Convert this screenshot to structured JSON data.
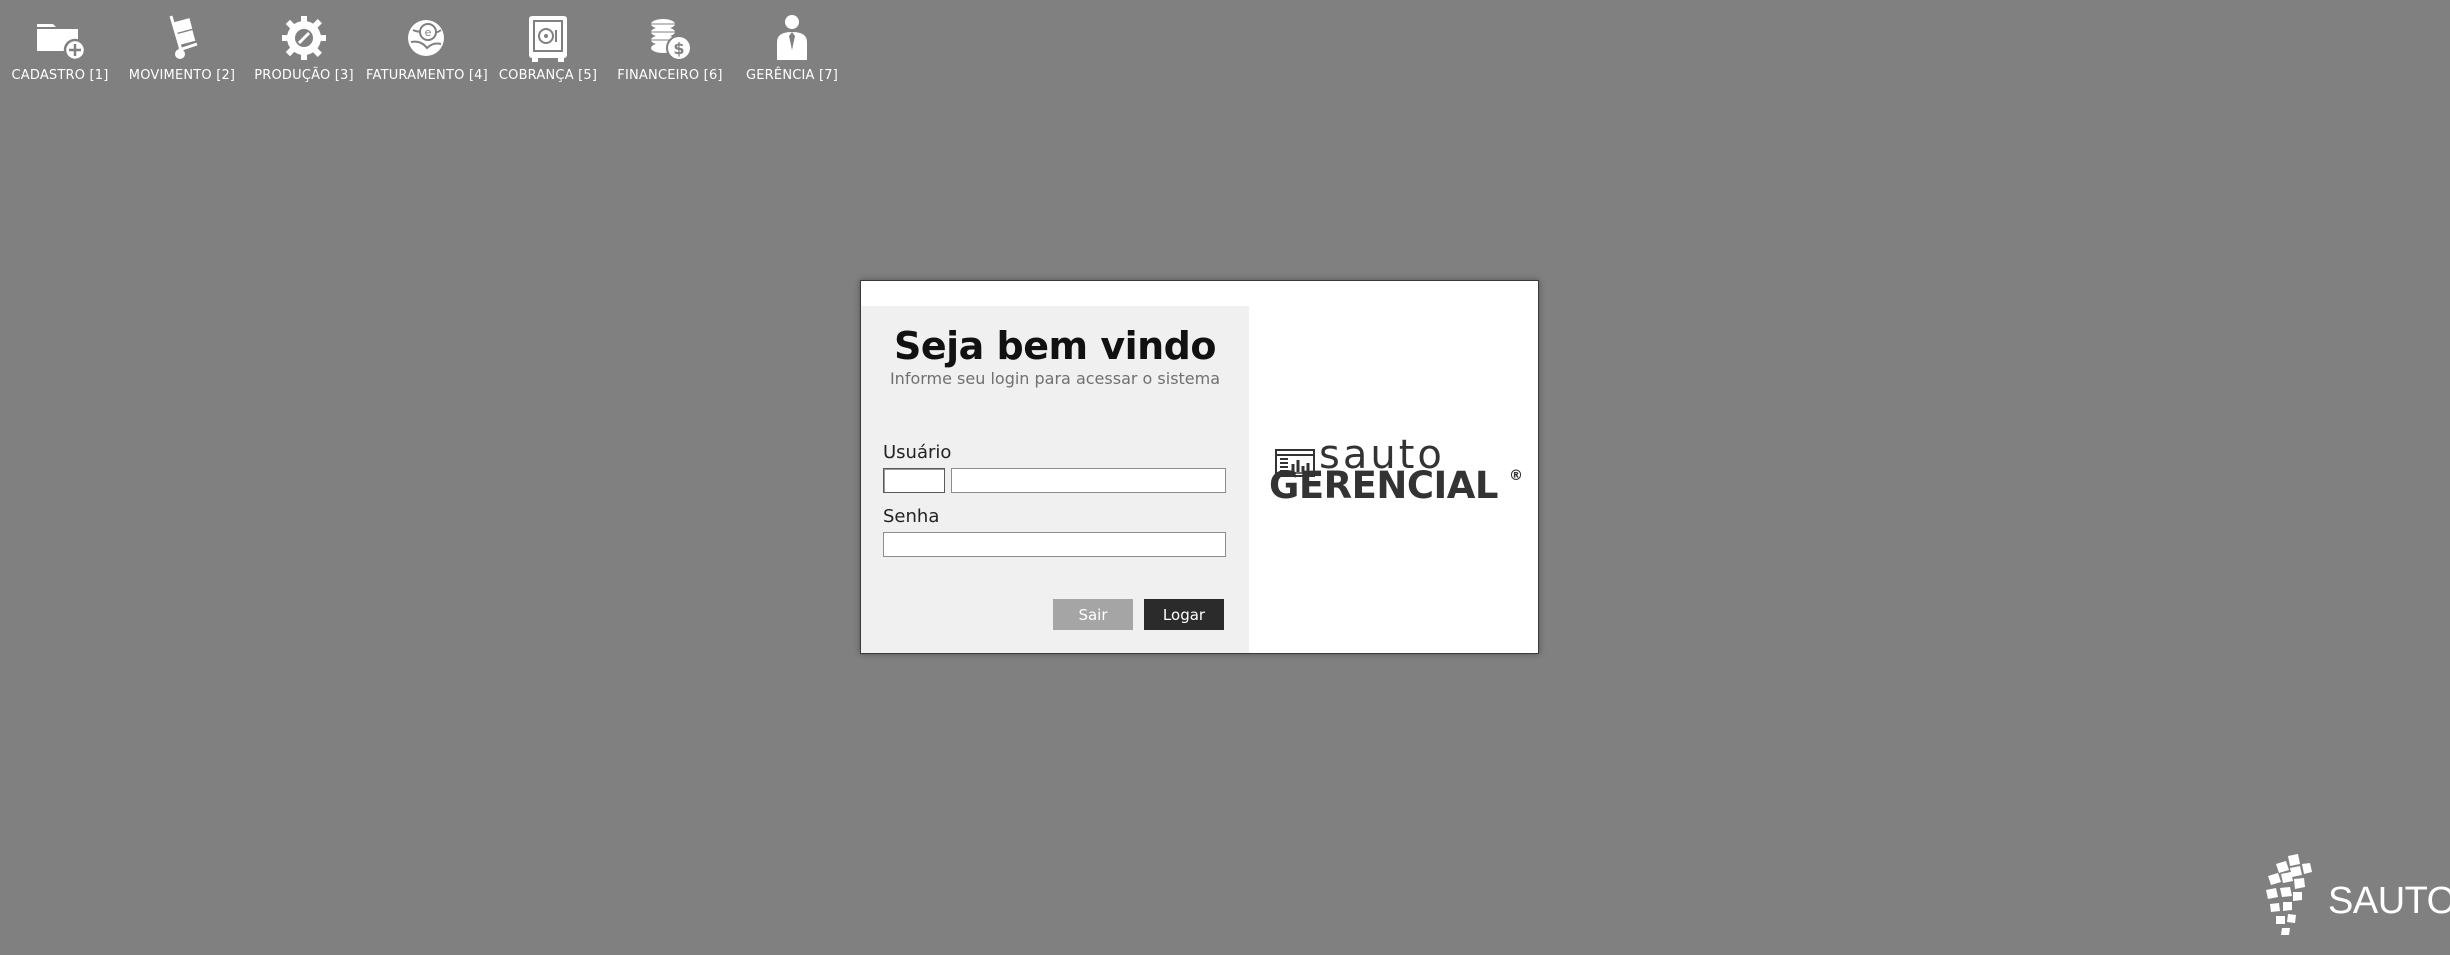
{
  "menu": [
    {
      "label": "CADASTRO [1]",
      "icon": "folder-add-icon"
    },
    {
      "label": "MOVIMENTO [2]",
      "icon": "hand-truck-icon"
    },
    {
      "label": "PRODUÇÃO [3]",
      "icon": "gear-wrench-icon"
    },
    {
      "label": "FATURAMENTO [4]",
      "icon": "globe-invoice-icon"
    },
    {
      "label": "COBRANÇA [5]",
      "icon": "safe-icon"
    },
    {
      "label": "FINANCEIRO [6]",
      "icon": "coins-dollar-icon"
    },
    {
      "label": "GERÊNCIA [7]",
      "icon": "manager-person-icon"
    }
  ],
  "login": {
    "title": "Seja bem vindo",
    "subtitle": "Informe seu login para acessar o sistema",
    "user_label": "Usuário",
    "user_code_value": "",
    "user_name_value": "",
    "password_label": "Senha",
    "password_value": "",
    "exit_button": "Sair",
    "login_button": "Logar"
  },
  "logo": {
    "top_text": "sauto",
    "bottom_text": "GERENCIAL",
    "registered_mark": "®"
  },
  "corner_brand": {
    "text": "SAUTO"
  },
  "colors": {
    "background": "#808080",
    "panel": "#f0f0f0",
    "login_button": "#2b2b2b",
    "exit_button": "#a5a5a5",
    "logo_text": "#333333"
  }
}
